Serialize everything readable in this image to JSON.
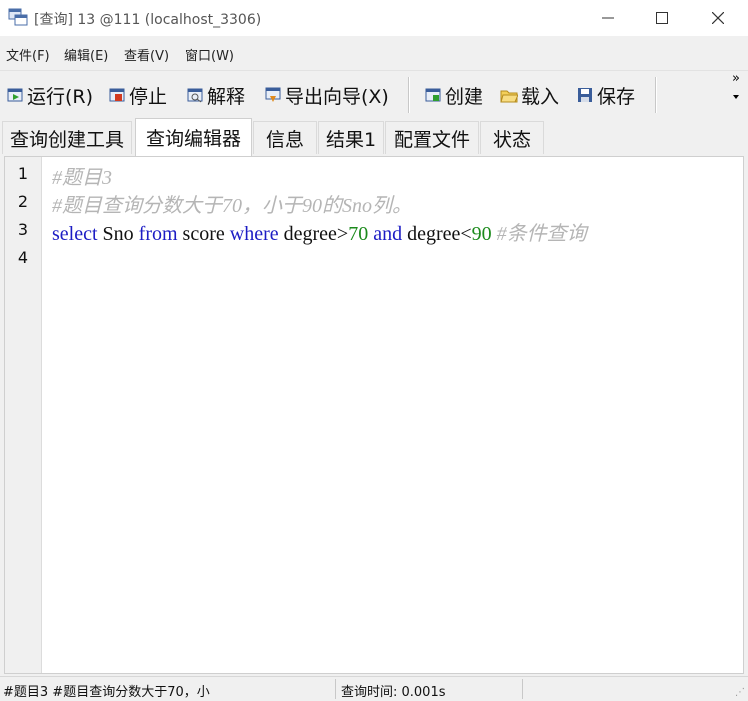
{
  "window": {
    "title": "[查询] 13 @111 (localhost_3306)",
    "min_glyph": "—",
    "max_glyph": "☐",
    "close_glyph": "✕"
  },
  "menu": [
    {
      "label": "文件(F)"
    },
    {
      "label": "编辑(E)"
    },
    {
      "label": "查看(V)"
    },
    {
      "label": "窗口(W)"
    }
  ],
  "toolbar": {
    "run": "运行(R)",
    "stop": "停止",
    "explain": "解释",
    "export": "导出向导(X)",
    "create": "创建",
    "load": "载入",
    "save": "保存",
    "more": "»"
  },
  "tabs": [
    {
      "label": "查询创建工具"
    },
    {
      "label": "查询编辑器",
      "active": true
    },
    {
      "label": "信息"
    },
    {
      "label": "结果1"
    },
    {
      "label": "配置文件"
    },
    {
      "label": "状态"
    }
  ],
  "editor": {
    "line_numbers": [
      "1",
      "2",
      "3",
      "4"
    ],
    "line1": "#题目3",
    "line2": "#题目查询分数大于70，小于90的Sno列。",
    "line3": {
      "t1": "select",
      "t2": " Sno ",
      "t3": "from",
      "t4": " score ",
      "t5": "where",
      "t6": " degree>",
      "t7": "70",
      "t8": " ",
      "t9": "and",
      "t10": " degree<",
      "t11": "90",
      "t12": " ",
      "t13": "#条件查询"
    }
  },
  "status": {
    "left": "#题目3 #题目查询分数大于70，小",
    "query_time": "查询时间: 0.001s"
  },
  "colors": {
    "keyword": "#1c1cc4",
    "number": "#1b8a1b",
    "comment": "#b5b5b5"
  }
}
